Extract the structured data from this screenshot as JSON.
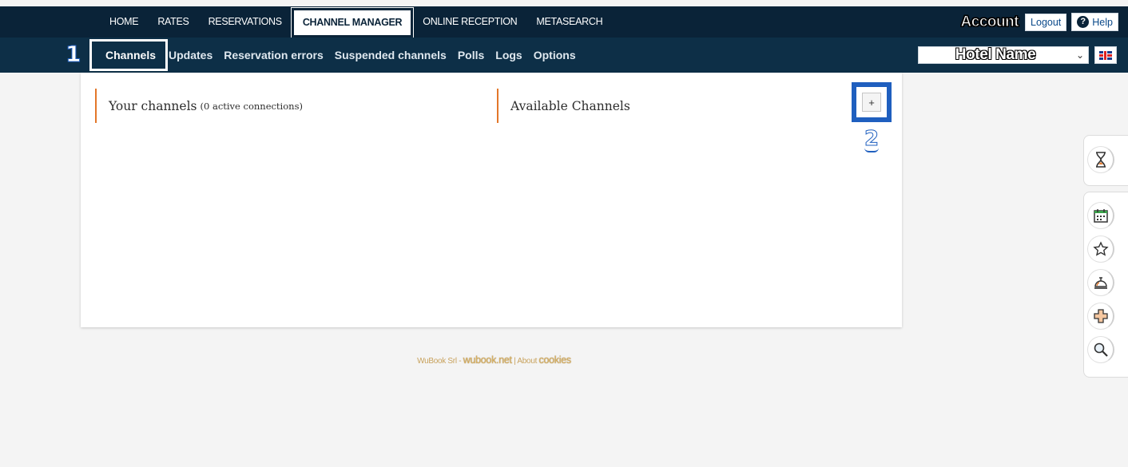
{
  "top_nav": {
    "items": [
      "HOME",
      "RATES",
      "RESERVATIONS",
      "CHANNEL MANAGER",
      "ONLINE RECEPTION",
      "METASEARCH"
    ],
    "active": "CHANNEL MANAGER"
  },
  "account": {
    "label": "Account",
    "logout": "Logout",
    "help": "Help"
  },
  "sub_nav": {
    "items": [
      "Channels",
      "Updates",
      "Reservation errors",
      "Suspended channels",
      "Polls",
      "Logs",
      "Options"
    ],
    "active": "Channels"
  },
  "hotel_select": {
    "value": "Hotel Name"
  },
  "annotations": {
    "step1": "1",
    "step2": "2"
  },
  "panel": {
    "your_channels": "Your channels",
    "active_connections": "(0 active connections)",
    "available_channels": "Available Channels",
    "add_button": "+"
  },
  "footer": {
    "company": "WuBook Srl -",
    "site": "wubook.net",
    "sep": "|",
    "about": "About",
    "cookies": "cookies"
  },
  "side_tools": {
    "icons": [
      "hourglass-icon",
      "calendar-icon",
      "star-icon",
      "reception-bell-icon",
      "plus-icon",
      "magnifier-icon"
    ]
  }
}
